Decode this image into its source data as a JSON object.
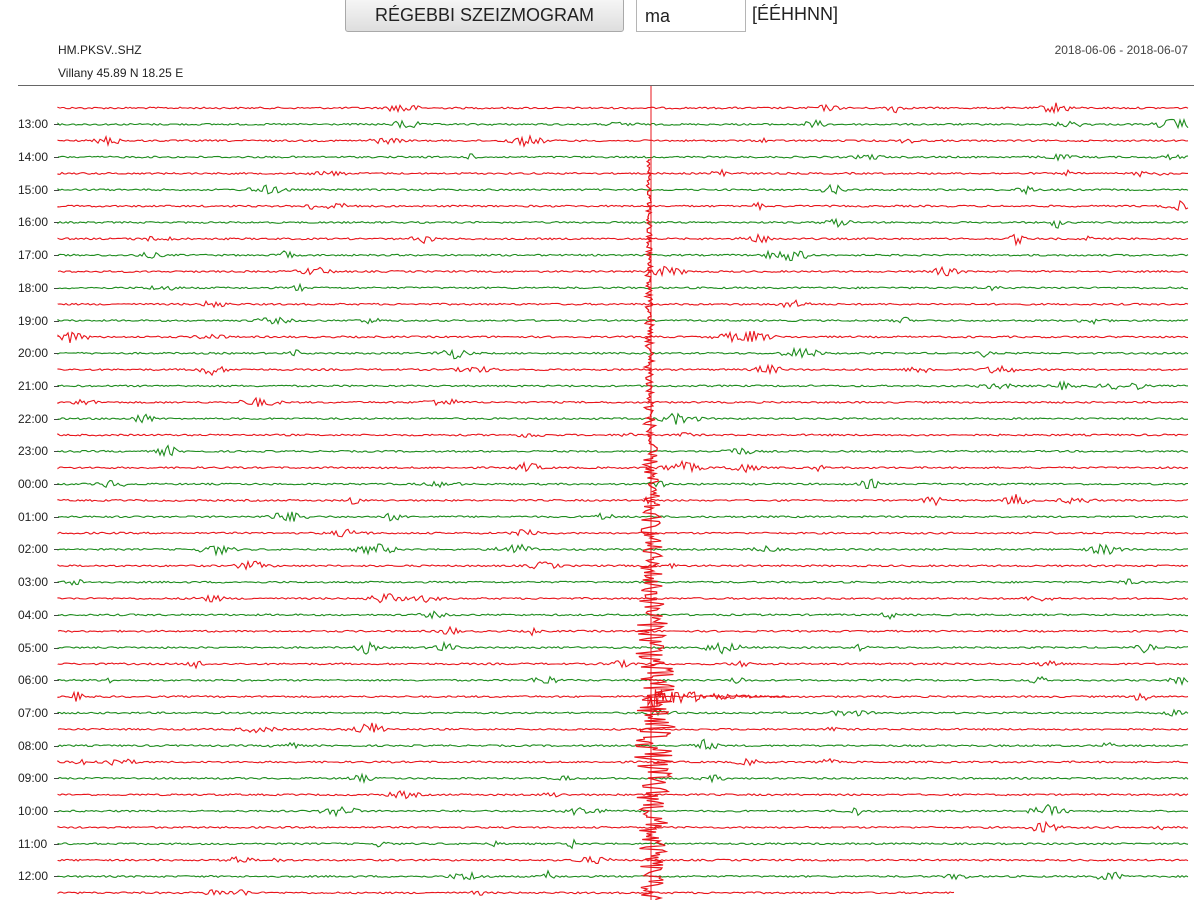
{
  "toolbar": {
    "older_button_label": "RÉGEBBI SZEIZMOGRAM",
    "date_input_value": "ma",
    "date_format_hint": "[ÉÉHHNN]"
  },
  "header": {
    "station": "HM.PKSV..SHZ",
    "location": "Villany  45.89 N 18.25 E",
    "date_range": "2018-06-06 - 2018-06-07"
  },
  "time_labels": [
    "13:00",
    "14:00",
    "15:00",
    "16:00",
    "17:00",
    "18:00",
    "19:00",
    "20:00",
    "21:00",
    "22:00",
    "23:00",
    "00:00",
    "01:00",
    "02:00",
    "03:00",
    "04:00",
    "05:00",
    "06:00",
    "07:00",
    "08:00",
    "09:00",
    "10:00",
    "11:00",
    "12:00"
  ],
  "trace_colors": {
    "odd": "#e8141b",
    "even": "#1e8c1e"
  },
  "event_marker_color": "#e8141b"
}
